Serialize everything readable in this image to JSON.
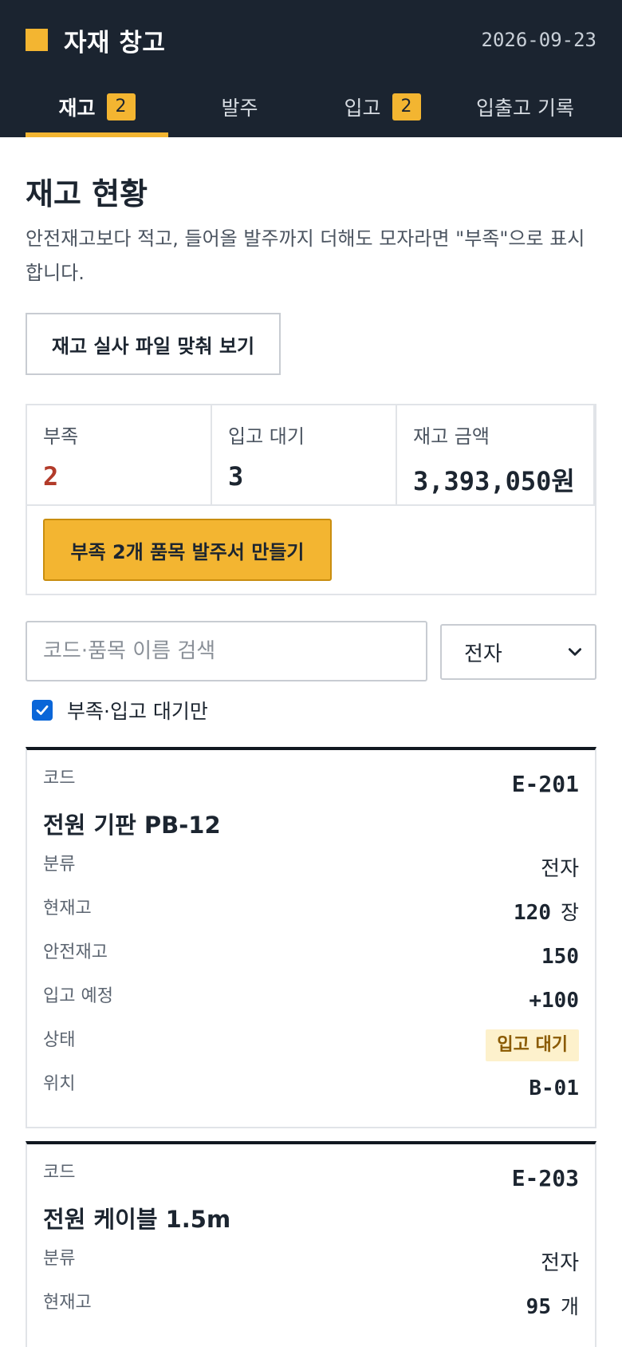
{
  "header": {
    "title": "자재 창고",
    "date": "2026-09-23",
    "colors": {
      "background": "#1b2430",
      "accent": "#f3b531"
    }
  },
  "tabs": [
    {
      "label": "재고",
      "badge": "2",
      "active": true
    },
    {
      "label": "발주",
      "badge": null,
      "active": false
    },
    {
      "label": "입고",
      "badge": "2",
      "active": false
    },
    {
      "label": "입출고 기록",
      "badge": null,
      "active": false
    }
  ],
  "main": {
    "title": "재고 현황",
    "description": "안전재고보다 적고, 들어올 발주까지 더해도 모자라면 \"부족\"으로 표시합니다.",
    "recon_button": "재고 실사 파일 맞춰 보기"
  },
  "summary": {
    "short_label": "부족",
    "short_value": "2",
    "pending_label": "입고 대기",
    "pending_value": "3",
    "amount_label": "재고 금액",
    "amount_value": "3,393,050원",
    "order_button": "부족 2개 품목 발주서 만들기"
  },
  "filters": {
    "search_placeholder": "코드·품목 이름 검색",
    "search_value": "",
    "category_selected": "전자",
    "checkbox_label": "부족·입고 대기만",
    "checkbox_checked": true
  },
  "labels": {
    "code": "코드",
    "category": "분류",
    "stock": "현재고",
    "safety": "안전재고",
    "incoming": "입고 예정",
    "status": "상태",
    "location": "위치"
  },
  "items": [
    {
      "code": "E-201",
      "name": "전원 기판 PB-12",
      "category": "전자",
      "stock": "120",
      "unit": "장",
      "safety": "150",
      "incoming": "+100",
      "status": "입고 대기",
      "location": "B-01"
    },
    {
      "code": "E-203",
      "name": "전원 케이블 1.5m",
      "category": "전자",
      "stock": "95",
      "unit": "개"
    }
  ]
}
